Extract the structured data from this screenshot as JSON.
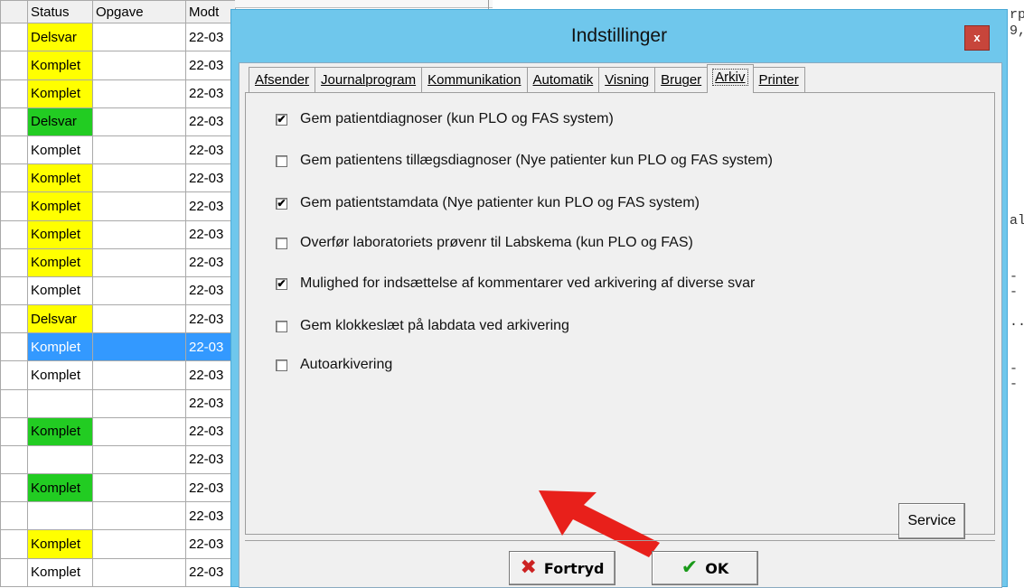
{
  "table": {
    "headers": [
      "",
      "Status",
      "Opgave",
      "Modt"
    ],
    "rows": [
      {
        "status": "Delsvar",
        "color": "yellow",
        "date": "22-03"
      },
      {
        "status": "Komplet",
        "color": "yellow",
        "date": "22-03"
      },
      {
        "status": "Komplet",
        "color": "yellow",
        "date": "22-03"
      },
      {
        "status": "Delsvar",
        "color": "green",
        "date": "22-03"
      },
      {
        "status": "Komplet",
        "color": "none",
        "date": "22-03"
      },
      {
        "status": "Komplet",
        "color": "yellow",
        "date": "22-03"
      },
      {
        "status": "Komplet",
        "color": "yellow",
        "date": "22-03"
      },
      {
        "status": "Komplet",
        "color": "yellow",
        "date": "22-03"
      },
      {
        "status": "Komplet",
        "color": "yellow",
        "date": "22-03"
      },
      {
        "status": "Komplet",
        "color": "none",
        "date": "22-03"
      },
      {
        "status": "Delsvar",
        "color": "yellow",
        "date": "22-03"
      },
      {
        "status": "Komplet",
        "color": "selected",
        "date": "22-03"
      },
      {
        "status": "Komplet",
        "color": "none",
        "date": "22-03"
      },
      {
        "status": "",
        "color": "none",
        "date": "22-03"
      },
      {
        "status": "Komplet",
        "color": "green",
        "date": "22-03"
      },
      {
        "status": "",
        "color": "none",
        "date": "22-03"
      },
      {
        "status": "Komplet",
        "color": "green",
        "date": "22-03"
      },
      {
        "status": "",
        "color": "none",
        "date": "22-03"
      },
      {
        "status": "Komplet",
        "color": "yellow",
        "date": "22-03"
      },
      {
        "status": "Komplet",
        "color": "none",
        "date": "22-03"
      }
    ]
  },
  "background_text": [
    {
      "text": "rp"
    },
    {
      "text": "9,"
    },
    {
      "text": "al"
    },
    {
      "text": "--"
    },
    {
      "text": ".."
    },
    {
      "text": "--"
    }
  ],
  "dialog": {
    "title": "Indstillinger",
    "close_label": "x",
    "tabs": [
      {
        "label": "Afsender",
        "active": false
      },
      {
        "label": "Journalprogram",
        "active": false
      },
      {
        "label": "Kommunikation",
        "active": false
      },
      {
        "label": "Automatik",
        "active": false
      },
      {
        "label": "Visning",
        "active": false
      },
      {
        "label": "Bruger",
        "active": false
      },
      {
        "label": "Arkiv",
        "active": true
      },
      {
        "label": "Printer",
        "active": false
      }
    ],
    "options": [
      {
        "label": "Gem patientdiagnoser (kun PLO og FAS system)",
        "checked": true
      },
      {
        "label": "Gem patientens tillægsdiagnoser (Nye patienter kun PLO og FAS system)",
        "checked": false
      },
      {
        "label": "Gem patientstamdata (Nye patienter kun PLO og FAS system)",
        "checked": true
      },
      {
        "label": "Overfør laboratoriets prøvenr til Labskema (kun PLO og FAS)",
        "checked": false
      },
      {
        "label": "Mulighed for indsættelse af kommentarer ved arkivering af diverse svar",
        "checked": true
      },
      {
        "label": "Gem klokkeslæt på labdata ved arkivering",
        "checked": false
      },
      {
        "label": "Autoarkivering",
        "checked": false
      }
    ],
    "service_label": "Service",
    "cancel_label": "Fortryd",
    "ok_label": "OK"
  },
  "colors": {
    "title_bar": "#6fc7ec",
    "status_yellow": "#ffff00",
    "status_green": "#22cc22",
    "selection": "#3399ff",
    "arrow": "#e8201b",
    "close": "#c7453b"
  }
}
